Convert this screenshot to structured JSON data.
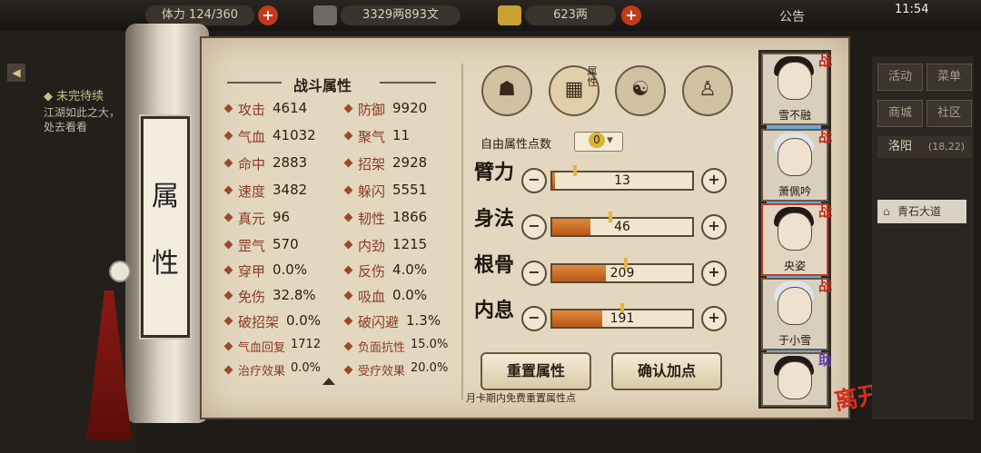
{
  "topbar": {
    "stamina": "体力 124/360",
    "money_silver": "3329两893文",
    "money_gold": "623两",
    "notice": "公告",
    "clock": "11:54"
  },
  "quest": {
    "title": "未完待续",
    "text": "江湖如此之大，处去看看"
  },
  "scroll": {
    "label": "属性"
  },
  "combat": {
    "title": "战斗属性",
    "stats": [
      {
        "label": "攻击",
        "value": "4614"
      },
      {
        "label": "防御",
        "value": "9920"
      },
      {
        "label": "气血",
        "value": "41032"
      },
      {
        "label": "聚气",
        "value": "11"
      },
      {
        "label": "命中",
        "value": "2883"
      },
      {
        "label": "招架",
        "value": "2928"
      },
      {
        "label": "速度",
        "value": "3482"
      },
      {
        "label": "躲闪",
        "value": "5551"
      },
      {
        "label": "真元",
        "value": "96"
      },
      {
        "label": "韧性",
        "value": "1866"
      },
      {
        "label": "罡气",
        "value": "570"
      },
      {
        "label": "内劲",
        "value": "1215"
      },
      {
        "label": "穿甲",
        "value": "0.0%"
      },
      {
        "label": "反伤",
        "value": "4.0%"
      },
      {
        "label": "免伤",
        "value": "32.8%"
      },
      {
        "label": "吸血",
        "value": "0.0%"
      },
      {
        "label": "破招架",
        "value": "0.0%"
      },
      {
        "label": "破闪避",
        "value": "1.3%"
      },
      {
        "label": "气血回复",
        "value": "1712"
      },
      {
        "label": "负面抗性",
        "value": "15.0%"
      },
      {
        "label": "治疗效果",
        "value": "0.0%"
      },
      {
        "label": "受疗效果",
        "value": "20.0%"
      }
    ]
  },
  "tabs": {
    "badge": "属性"
  },
  "allocation": {
    "free_points_label": "自由属性点数",
    "free_points": "0",
    "attrs": [
      {
        "name": "臂力",
        "value": "13",
        "fill": 0.02
      },
      {
        "name": "身法",
        "value": "46",
        "fill": 0.27
      },
      {
        "name": "根骨",
        "value": "209",
        "fill": 0.38
      },
      {
        "name": "内息",
        "value": "191",
        "fill": 0.36
      }
    ],
    "minus_symbol": "−",
    "plus_symbol": "+"
  },
  "buttons": {
    "reset": "重置属性",
    "confirm": "确认加点"
  },
  "footer_note": "月卡期内免费重置属性点",
  "roster": [
    {
      "name": "雪不融",
      "badge": "战"
    },
    {
      "name": "萧佩吟",
      "badge": "战"
    },
    {
      "name": "央姿",
      "badge": "战"
    },
    {
      "name": "于小雪",
      "badge": "战"
    },
    {
      "name": "",
      "badge": "助"
    }
  ],
  "leave_label": "离开",
  "right_panel": {
    "buttons": [
      "活动",
      "菜单",
      "商城",
      "社区"
    ],
    "location": "洛阳",
    "location_coords": "(18,22)",
    "sub_location": "青石大道"
  },
  "colors": {
    "accent_red": "#c23a1c",
    "panel_bg": "#e3d7bf",
    "bar_fill": "#d8722a"
  }
}
